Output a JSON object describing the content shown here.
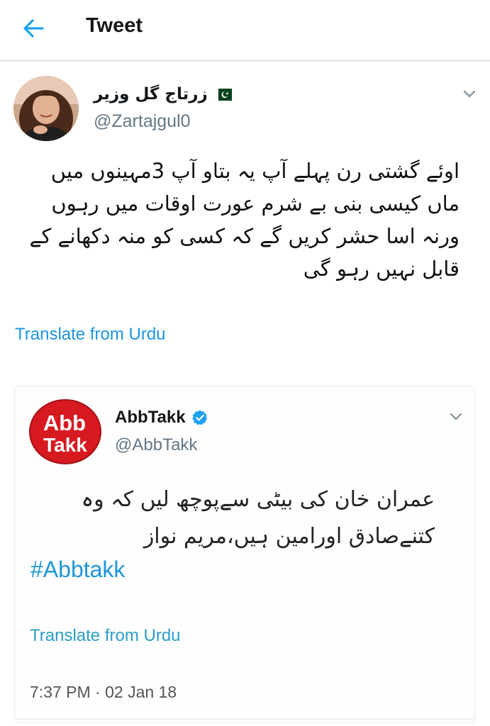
{
  "header": {
    "title": "Tweet",
    "back_icon": "arrow-left-icon",
    "accent": "#1da1f2"
  },
  "tweet": {
    "display_name": "زرتاج گل وزیر",
    "flag_icon": "pakistan-flag-icon",
    "handle": "@Zartajgul0",
    "text": "اوئے گشتی رن پہلے آپ یہ بتاو آپ 3مہینوں میں ماں کیسی بنی بے شرم عورت اوقات میں رہوں ورنہ اسا حشر کریں گے کہ کسی کو منہ دکھانے کے قابل نہیں رہو گی",
    "translate_label": "Translate from Urdu",
    "link_color": "#1b95e0"
  },
  "quoted_tweet": {
    "display_name": "AbbTakk",
    "verified_icon": "verified-badge-icon",
    "handle": "@AbbTakk",
    "logo_line1": "Abb",
    "logo_line2": "Takk",
    "text": "عمران خان کی بیٹی سےپوچھ لیں کہ وہ کتنےصادق اورامین ہیں،مریم نواز",
    "hashtag": "#Abbtakk",
    "translate_label": "Translate from Urdu",
    "timestamp": "7:37 PM · 02 Jan 18",
    "brand_color": "#d71920"
  }
}
